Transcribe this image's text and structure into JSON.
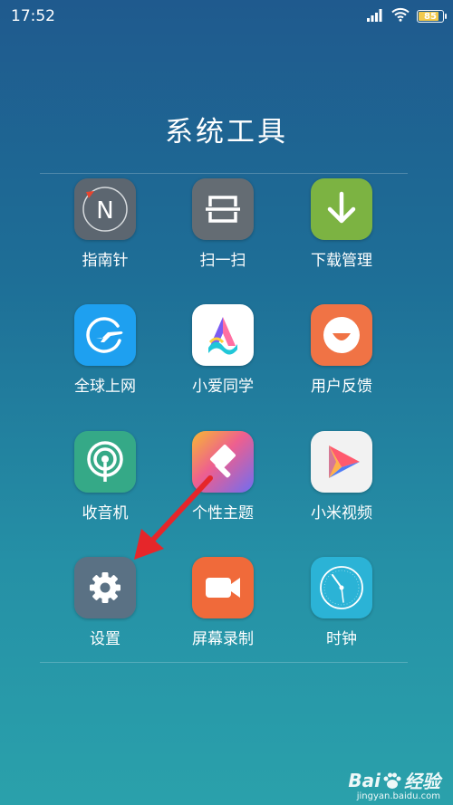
{
  "status_bar": {
    "time": "17:52",
    "battery_level": "85",
    "battery_fraction": 0.85,
    "signal_icon": "cellular-signal-icon",
    "wifi_icon": "wifi-icon"
  },
  "folder": {
    "title": "系统工具"
  },
  "apps": [
    {
      "label": "指南针",
      "icon": "compass-icon",
      "color": "#5c6670"
    },
    {
      "label": "扫一扫",
      "icon": "scanner-icon",
      "color": "#646c73"
    },
    {
      "label": "下载管理",
      "icon": "download-icon",
      "color": "#7cb342"
    },
    {
      "label": "全球上网",
      "icon": "globe-plane-icon",
      "color": "#1ea0f0"
    },
    {
      "label": "小爱同学",
      "icon": "xiaoai-icon",
      "color": "#ffffff"
    },
    {
      "label": "用户反馈",
      "icon": "smile-icon",
      "color": "#f07345"
    },
    {
      "label": "收音机",
      "icon": "radio-icon",
      "color": "#35a987"
    },
    {
      "label": "个性主题",
      "icon": "theme-brush-icon",
      "color": "#e95c8b"
    },
    {
      "label": "小米视频",
      "icon": "video-play-icon",
      "color": "#f2f2f2"
    },
    {
      "label": "设置",
      "icon": "gear-icon",
      "color": "#5a7184"
    },
    {
      "label": "屏幕录制",
      "icon": "video-camera-icon",
      "color": "#f06a3a"
    },
    {
      "label": "时钟",
      "icon": "clock-icon",
      "color": "#2bb3d6"
    }
  ],
  "annotation": {
    "arrow_color": "#e6262a"
  },
  "watermark": {
    "brand": "Bai",
    "brand_suffix": "经验",
    "url": "jingyan.baidu.com"
  }
}
